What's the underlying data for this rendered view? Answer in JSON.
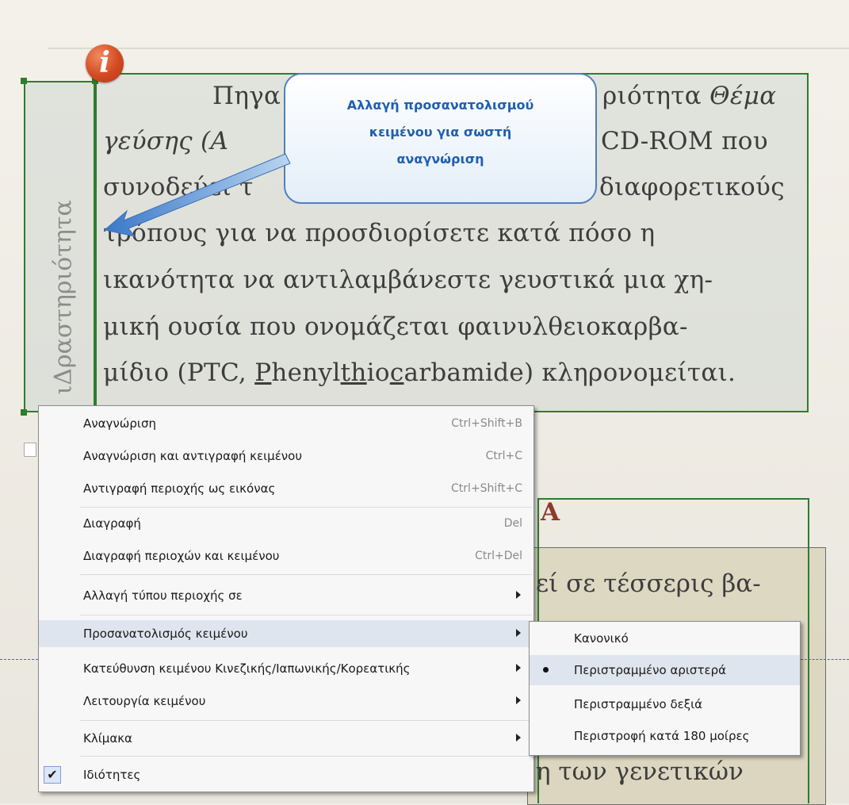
{
  "document": {
    "lines": [
      {
        "text": "Πηγαίνετε στη Δραστηριότητα ",
        "italic": "Θέμα"
      },
      {
        "text": "γεύσης (Α",
        "rest": "CD-ROM που"
      },
      {
        "text": "συνοδεύει τ",
        "rest": "διαφορετικούς"
      },
      {
        "text": "τρόπους για να προσδιορίσετε κατά πόσο η"
      },
      {
        "text": "ικανότητα να αντιλαμβάνεστε γευστικά μια χη-"
      },
      {
        "text": "μική ουσία που ονομάζεται φαινυλθειοκαρβα-"
      },
      {
        "pre": "μίδιο (PTC, ",
        "u1": "P",
        "mid1": "henyl",
        "u2": "th",
        "mid2": "io",
        "u3": "c",
        "post": "arbamide) κληρονομείται."
      }
    ],
    "line1_left": "Πηγα",
    "line1_right": "ριότητα ",
    "line1_italic": "Θέμα",
    "line2_left": "γεύσης (Α",
    "line2_right": "CD-ROM που",
    "line3_left": "συνοδεύει τ",
    "line3_right": "διαφορετικούς",
    "vertical_text": "ιΔραστηριότητα",
    "lower_line1": "εί σε τέσσερις βα-",
    "lower_line_last": "η των γενετικών",
    "lower_A": "Α"
  },
  "callout": {
    "text": "Αλλαγή προσανατολισμού\nκειμένου για σωστή\nαναγνώριση"
  },
  "info_icon": {
    "glyph": "i"
  },
  "context_menu": {
    "items": [
      {
        "label": "Αναγνώριση",
        "shortcut": "Ctrl+Shift+B"
      },
      {
        "label": "Αναγνώριση και αντιγραφή κειμένου",
        "shortcut": "Ctrl+C"
      },
      {
        "label": "Αντιγραφή περιοχής ως εικόνας",
        "shortcut": "Ctrl+Shift+C"
      },
      {
        "label": "Διαγραφή",
        "shortcut": "Del"
      },
      {
        "label": "Διαγραφή περιοχών και κειμένου",
        "shortcut": "Ctrl+Del"
      },
      {
        "label": "Αλλαγή τύπου περιοχής σε",
        "shortcut": ""
      },
      {
        "label": "Προσανατολισμός κειμένου",
        "shortcut": ""
      },
      {
        "label": "Κατεύθυνση κειμένου Κινεζικής/Ιαπωνικής/Κορεατικής",
        "shortcut": ""
      },
      {
        "label": "Λειτουργία κειμένου",
        "shortcut": ""
      },
      {
        "label": "Κλίμακα",
        "shortcut": ""
      },
      {
        "label": "Ιδιότητες",
        "shortcut": "",
        "checked": "✔"
      }
    ]
  },
  "submenu": {
    "items": [
      {
        "label": "Κανονικό"
      },
      {
        "label": "Περιστραμμένο αριστερά",
        "selected": true
      },
      {
        "label": "Περιστραμμένο δεξιά"
      },
      {
        "label": "Περιστροφή κατά 180 μοίρες"
      }
    ]
  },
  "colors": {
    "region_border": "#2d7d2d",
    "callout_text": "#1f5fb0",
    "menu_highlight": "#dfe5ee"
  }
}
